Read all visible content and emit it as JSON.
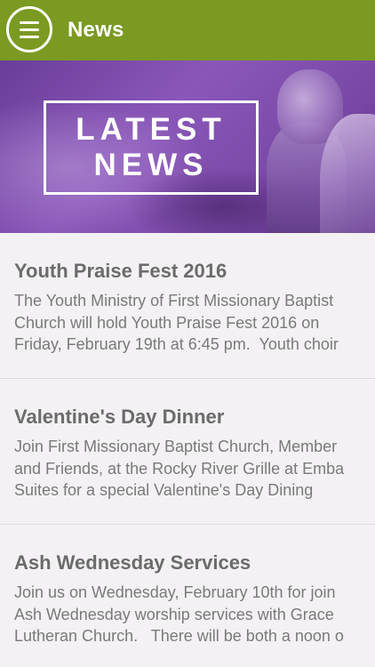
{
  "header": {
    "menu_icon": "hamburger-menu-icon",
    "title": "News",
    "color": "#7a9a22"
  },
  "banner": {
    "line1": "LATEST",
    "line2": "NEWS",
    "accent": "#7a4aa8"
  },
  "news": [
    {
      "title": "Youth Praise Fest 2016",
      "lines": [
        "The Youth Ministry of First Missionary Baptist",
        "Church will hold Youth Praise Fest 2016 on",
        "Friday, February 19th at 6:45 pm.  Youth choir"
      ]
    },
    {
      "title": "Valentine's Day Dinner",
      "lines": [
        "Join First Missionary Baptist Church, Member",
        "and Friends, at the Rocky River Grille at Emba",
        "Suites for a special Valentine's Day Dining"
      ]
    },
    {
      "title": "Ash Wednesday Services",
      "lines": [
        "Join us on Wednesday, February 10th for join",
        "Ash Wednesday worship services with Grace",
        "Lutheran Church.   There will be both a noon o"
      ]
    }
  ]
}
